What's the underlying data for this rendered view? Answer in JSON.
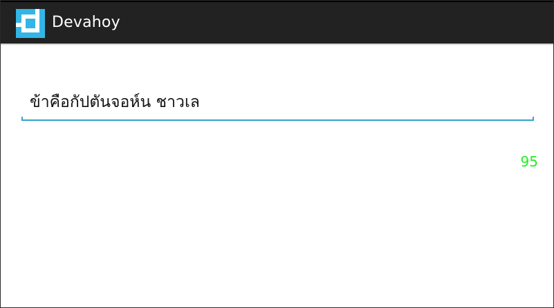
{
  "app": {
    "title": "Devahoy",
    "icon": "devahoy-logo-icon",
    "icon_color": "#33b5e5"
  },
  "editor": {
    "value": "ข้าคือกัปตันจอห์น ชาวเล",
    "accent_color": "#33a3cc"
  },
  "counter": {
    "value": "95",
    "color": "#22ee22"
  }
}
